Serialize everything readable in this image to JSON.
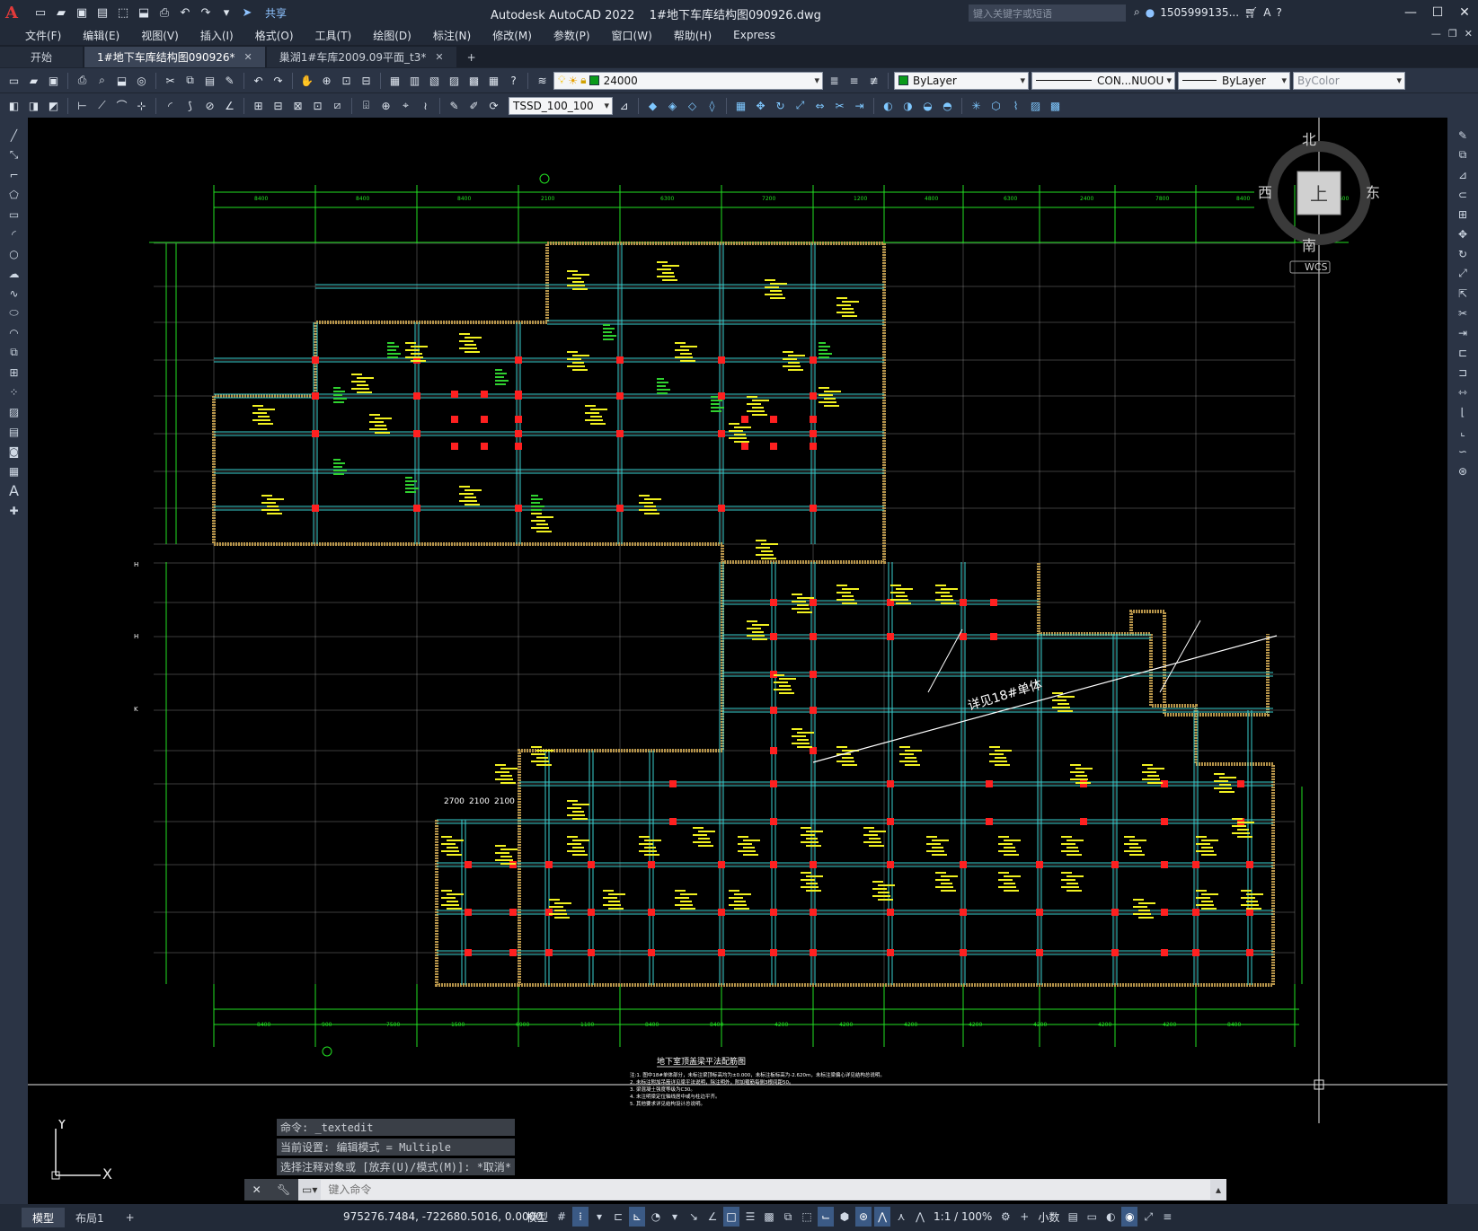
{
  "app": {
    "title": "Autodesk AutoCAD 2022    1#地下车库结构图090926.dwg",
    "share_label": "共享",
    "search_placeholder": "键入关键字或短语",
    "user_name": "1505999135...",
    "logo_letter": "A"
  },
  "menu": {
    "items": [
      "文件(F)",
      "编辑(E)",
      "视图(V)",
      "插入(I)",
      "格式(O)",
      "工具(T)",
      "绘图(D)",
      "标注(N)",
      "修改(M)",
      "参数(P)",
      "窗口(W)",
      "帮助(H)",
      "Express"
    ]
  },
  "doc_tabs": {
    "start_label": "开始",
    "tabs": [
      {
        "label": "1#地下车库结构图090926*",
        "active": true
      },
      {
        "label": "巢湖1#车库2009.09平面_t3*",
        "active": false
      }
    ],
    "add_label": "+"
  },
  "properties": {
    "layer_name": "24000",
    "color": "ByLayer",
    "linetype": "CON...NUOU",
    "lineweight": "ByLayer",
    "plotstyle": "ByColor",
    "dim_style": "TSSD_100_100",
    "layer_color": "#0a9a1a"
  },
  "drawing": {
    "plan_title": "地下室顶盖梁平法配筋图",
    "annotation": "详见18#单体",
    "notes": [
      "注:1. 图中18#单体部分，未标注梁顶标高均为±0.000，未标注板标高为-2.620m，未标注梁偏心详见结构总说明。",
      "2. 未标注附加吊筋详见梁平法说明，除注明外，附加箍筋每侧3根间距50。",
      "3. 梁混凝土强度等级为C30。",
      "4. 未注明梁定位轴线居中或与柱边平齐。",
      "5. 其他要求详见结构设计总说明。"
    ],
    "dims_top": [
      "8400",
      "8400",
      "8400",
      "2100",
      "6300",
      "7200",
      "1200",
      "4800",
      "6300",
      "2400",
      "7800",
      "8400",
      "3600"
    ],
    "dims_bottom": [
      "8400",
      "900",
      "7500",
      "1500",
      "6900",
      "1100",
      "8400",
      "8400",
      "4200",
      "4200",
      "4200",
      "4200",
      "4200",
      "4200",
      "4200",
      "8400"
    ],
    "dims_bottom_left": [
      "2700",
      "2100",
      "2100"
    ],
    "viewcube": {
      "north": "北",
      "south": "南",
      "east": "东",
      "west": "西",
      "face": "上",
      "wcs": "WCS"
    },
    "ucs_x": "X",
    "ucs_y": "Y"
  },
  "command": {
    "history": [
      "命令: _textedit",
      "当前设置: 编辑模式 = Multiple",
      "选择注释对象或 [放弃(U)/模式(M)]: *取消*"
    ],
    "placeholder": "键入命令"
  },
  "status": {
    "model_tab": "模型",
    "layout_tab": "布局1",
    "add_tab": "+",
    "coords": "975276.7484, -722680.5016, 0.0000",
    "space": "模型",
    "scale": "1:1 / 100%",
    "units": "小数"
  },
  "colors": {
    "beam": "#3ad0d0",
    "column": "#ff2020",
    "axis": "#d8d8d8",
    "dimension": "#22e022",
    "wall": "#b8954a",
    "rebar_text": "#f0f020"
  }
}
